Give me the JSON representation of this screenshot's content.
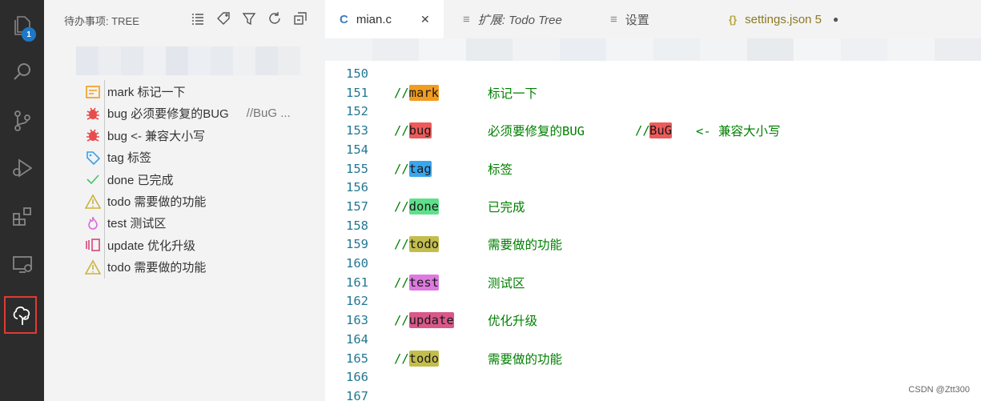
{
  "activity_bar": {
    "explorer_badge": "1",
    "items": [
      "explorer-icon",
      "search-icon",
      "source-control-icon",
      "run-debug-icon",
      "extensions-icon",
      "remote-explorer-icon",
      "todo-tree-icon"
    ]
  },
  "sidebar": {
    "title": "待办事项: TREE",
    "actions": [
      "list-view-icon",
      "tag-icon",
      "filter-icon",
      "refresh-icon",
      "collapse-all-icon"
    ],
    "items": [
      {
        "label": "mark 标记一下",
        "extra": "",
        "icon": "note-icon",
        "color": "#f29c1f"
      },
      {
        "label": "bug 必须要修复的BUG",
        "extra": "//BuG   ...",
        "icon": "bug-icon",
        "color": "#e84d4d"
      },
      {
        "label": "bug <- 兼容大小写",
        "extra": "",
        "icon": "bug-icon",
        "color": "#e84d4d"
      },
      {
        "label": "tag 标签",
        "extra": "",
        "icon": "tag-icon",
        "color": "#3aa0e8"
      },
      {
        "label": "done 已完成",
        "extra": "",
        "icon": "check-icon",
        "color": "#43c26b"
      },
      {
        "label": "todo 需要做的功能",
        "extra": "",
        "icon": "warning-icon",
        "color": "#c9b43a"
      },
      {
        "label": "test 测试区",
        "extra": "",
        "icon": "flame-icon",
        "color": "#d86ad8"
      },
      {
        "label": "update 优化升级",
        "extra": "",
        "icon": "update-icon",
        "color": "#d6457c"
      },
      {
        "label": "todo 需要做的功能",
        "extra": "",
        "icon": "warning-icon",
        "color": "#c9b43a"
      }
    ]
  },
  "tabs": [
    {
      "icon": "C",
      "label": "mian.c",
      "close": "✕",
      "active": true
    },
    {
      "icon": "≡",
      "label": "扩展: Todo Tree",
      "close": "",
      "active": false
    },
    {
      "icon": "≡",
      "label": "设置",
      "close": "",
      "active": false
    },
    {
      "icon": "{}",
      "label": "settings.json 5",
      "close": "●",
      "active": false
    }
  ],
  "editor": {
    "lines": [
      {
        "num": "150",
        "slash": "",
        "tag": "",
        "tag_color": "",
        "text": ""
      },
      {
        "num": "151",
        "slash": "//",
        "tag": "mark",
        "tag_color": "#f29c1f",
        "text": "标记一下"
      },
      {
        "num": "152",
        "slash": "",
        "tag": "",
        "tag_color": "",
        "text": ""
      },
      {
        "num": "153",
        "slash": "//",
        "tag": "bug",
        "tag_color": "#ee5a5a",
        "text": "必须要修复的BUG",
        "slash2": "//",
        "tag2": "BuG",
        "text2": "<- 兼容大小写"
      },
      {
        "num": "154",
        "slash": "",
        "tag": "",
        "tag_color": "",
        "text": ""
      },
      {
        "num": "155",
        "slash": "//",
        "tag": "tag",
        "tag_color": "#3aa6ee",
        "text": "标签"
      },
      {
        "num": "156",
        "slash": "",
        "tag": "",
        "tag_color": "",
        "text": ""
      },
      {
        "num": "157",
        "slash": "//",
        "tag": "done",
        "tag_color": "#5ee08a",
        "text": "已完成"
      },
      {
        "num": "158",
        "slash": "",
        "tag": "",
        "tag_color": "",
        "text": ""
      },
      {
        "num": "159",
        "slash": "//",
        "tag": "todo",
        "tag_color": "#c3bd4e",
        "text": "需要做的功能"
      },
      {
        "num": "160",
        "slash": "",
        "tag": "",
        "tag_color": "",
        "text": ""
      },
      {
        "num": "161",
        "slash": "//",
        "tag": "test",
        "tag_color": "#dd7ae0",
        "text": "测试区"
      },
      {
        "num": "162",
        "slash": "",
        "tag": "",
        "tag_color": "",
        "text": ""
      },
      {
        "num": "163",
        "slash": "//",
        "tag": "update",
        "tag_color": "#d9588a",
        "text": "优化升级"
      },
      {
        "num": "164",
        "slash": "",
        "tag": "",
        "tag_color": "",
        "text": ""
      },
      {
        "num": "165",
        "slash": "//",
        "tag": "todo",
        "tag_color": "#c3bd4e",
        "text": "需要做的功能"
      },
      {
        "num": "166",
        "slash": "",
        "tag": "",
        "tag_color": "",
        "text": ""
      },
      {
        "num": "167",
        "slash": "",
        "tag": "",
        "tag_color": "",
        "text": ""
      }
    ]
  },
  "watermark": "CSDN @Ztt300"
}
